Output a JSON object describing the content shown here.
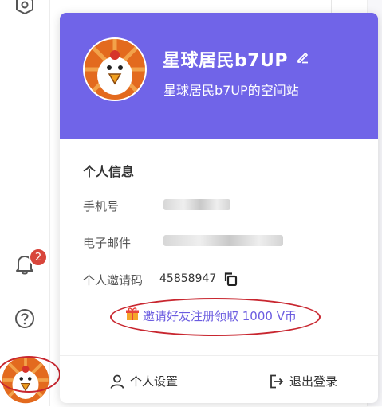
{
  "sidebar": {
    "icons": [
      "shield-icon",
      "bell-icon",
      "help-icon"
    ],
    "notification_count": "2"
  },
  "profile": {
    "username": "星球居民b7UP",
    "space_name": "星球居民b7UP的空间站"
  },
  "info": {
    "section_title": "个人信息",
    "phone_label": "手机号",
    "email_label": "电子邮件",
    "invite_code_label": "个人邀请码",
    "invite_code_value": "45858947"
  },
  "invite": {
    "text": "邀请好友注册领取 1000 V币"
  },
  "footer": {
    "settings_label": "个人设置",
    "logout_label": "退出登录"
  },
  "colors": {
    "header_bg": "#7064e8",
    "accent_link": "#6b5ce0",
    "badge": "#d8453b",
    "annotation_ring": "#c8262f"
  }
}
